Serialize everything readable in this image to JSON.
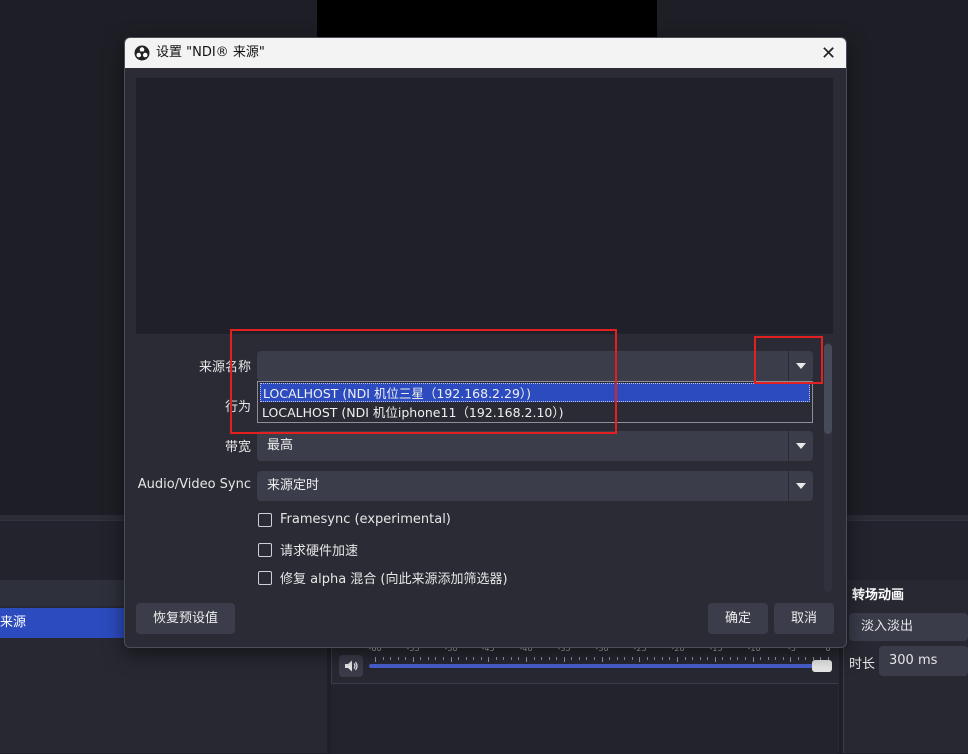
{
  "background": {
    "source_item": "来源",
    "transitions": {
      "title": "转场动画",
      "selected": "淡入淡出",
      "duration_label": "时长",
      "duration_value": "300 ms"
    },
    "mixer_scale": [
      "-60",
      "-55",
      "-50",
      "-45",
      "-40",
      "-35",
      "-30",
      "-25",
      "-20",
      "-15",
      "-10",
      "-5",
      "0"
    ]
  },
  "dialog": {
    "title": "设置 \"NDI® 来源\"",
    "close_glyph": "✕",
    "fields": {
      "source_name_label": "来源名称",
      "source_name_value": "",
      "behavior_label": "行为",
      "bandwidth_label": "带宽",
      "bandwidth_value": "最高",
      "sync_label": "Audio/Video Sync",
      "sync_value": "来源定时"
    },
    "dropdown_options": [
      "LOCALHOST (NDI 机位三星（192.168.2.29）)",
      "LOCALHOST (NDI 机位iphone11（192.168.2.10）)"
    ],
    "checkboxes": [
      {
        "label": "Framesync (experimental)",
        "checked": false
      },
      {
        "label": "请求硬件加速",
        "checked": false
      },
      {
        "label": "修复 alpha 混合 (向此来源添加筛选器)",
        "checked": false
      }
    ],
    "buttons": {
      "restore_defaults": "恢复预设值",
      "ok": "确定",
      "cancel": "取消"
    }
  },
  "colors": {
    "accent": "#2c4bbf",
    "annotation": "#e32020"
  }
}
